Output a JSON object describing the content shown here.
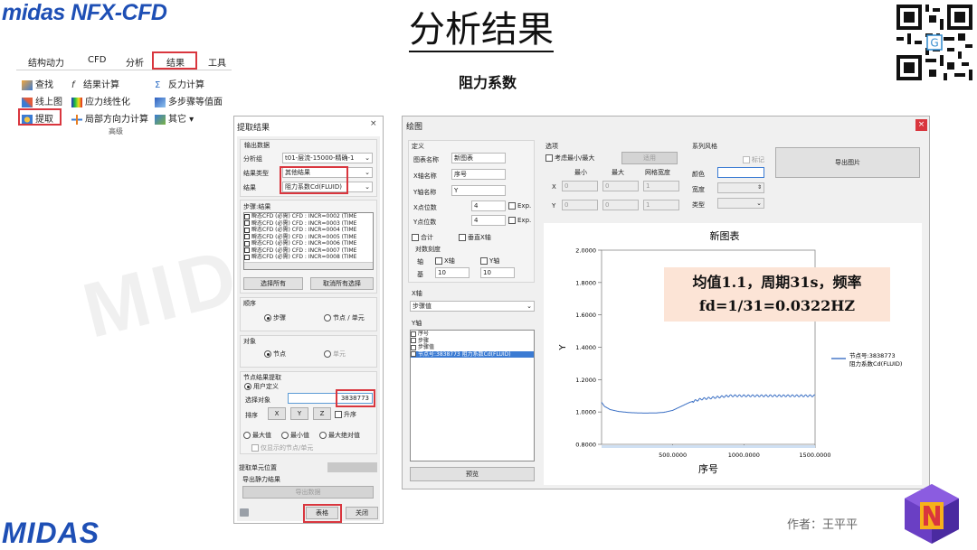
{
  "logo_top": "midas NFX-CFD",
  "logo_bottom": "MIDAS",
  "page_title": "分析结果",
  "subtitle": "阻力系数",
  "author": "作者：王平平",
  "watermark": "MIDAS",
  "ribbon": {
    "tabs": [
      "结构动力",
      "CFD",
      "分析",
      "结果",
      "工具"
    ],
    "items": {
      "find": "查找",
      "result_calc": "结果计算",
      "reaction_calc": "反力计算",
      "line_plot": "线上图",
      "stress_line": "应力线性化",
      "multistep_iso": "多步骤等值面",
      "extract": "提取",
      "local_dir": "局部方向力计算",
      "other": "其它",
      "group": "高级"
    }
  },
  "extract_dialog": {
    "title": "提取结果",
    "close": "×",
    "output_data": "输出数据",
    "analysis_group_label": "分析组",
    "analysis_group_value": "t01-层流-15000-精确-1",
    "result_type_label": "结果类型",
    "result_type_value": "其他结果",
    "result_label": "结果",
    "result_value": "阻力系数Cd(FLUID)",
    "steps_label": "步骤:结果",
    "steps": [
      "瞬态CFD (必需) CFD : INCR=0002 (TIME",
      "瞬态CFD (必需) CFD : INCR=0003 (TIME",
      "瞬态CFD (必需) CFD : INCR=0004 (TIME",
      "瞬态CFD (必需) CFD : INCR=0005 (TIME",
      "瞬态CFD (必需) CFD : INCR=0006 (TIME",
      "瞬态CFD (必需) CFD : INCR=0007 (TIME",
      "瞬态CFD (必需) CFD : INCR=0008 (TIME"
    ],
    "select_all": "选择所有",
    "deselect_all": "取消所有选择",
    "order_label": "顺序",
    "order_step": "步骤",
    "order_node": "节点 / 单元",
    "object_label": "对象",
    "object_node": "节点",
    "object_elem": "单元",
    "node_extract_label": "节点结果提取",
    "user_defined": "用户定义",
    "select_object": "选择对象",
    "select_value": "3838773",
    "sort_label": "排序",
    "sort_x": "X",
    "sort_y": "Y",
    "sort_z": "Z",
    "ascending": "升序",
    "max": "最大值",
    "min": "最小值",
    "abs_max": "最大绝对值",
    "only_shown": "仅显示的节点/单元",
    "elem_position": "提取单元位置",
    "export_static": "导出静力结果",
    "export_data": "导出数据",
    "table_btn": "表格",
    "close_btn": "关闭"
  },
  "graph_dialog": {
    "title": "绘图",
    "close": "×",
    "define_label": "定义",
    "chart_name_label": "图表名称",
    "chart_name_value": "新图表",
    "x_axis_name_label": "X轴名称",
    "x_axis_name_value": "序号",
    "y_axis_name_label": "Y轴名称",
    "y_axis_name_value": "Y",
    "x_digits_label": "X点位数",
    "x_digits_value": "4",
    "y_digits_label": "Y点位数",
    "y_digits_value": "4",
    "exp": "Exp.",
    "sum": "合计",
    "vertical_x": "垂直X轴",
    "log_scale": "对数刻度",
    "axis": "轴",
    "x_axis": "X轴",
    "y_axis": "Y轴",
    "base": "基",
    "base_x": "10",
    "base_y": "10",
    "x_axis_group": "X轴",
    "x_axis_select": "步骤值",
    "y_axis_group": "Y轴",
    "y_items": [
      "序号",
      "步骤",
      "步骤值",
      "节点号:3838773 阻力系数Cd(FLUID)"
    ],
    "preview": "预览",
    "options_label": "选项",
    "consider_minmax": "考虑最小/最大",
    "apply": "适用",
    "min": "最小",
    "max": "最大",
    "grid_width": "网格宽度",
    "opt_x": "X",
    "opt_y": "Y",
    "opt_x_min": "0",
    "opt_x_max": "0",
    "opt_x_grid": "1",
    "opt_y_min": "0",
    "opt_y_max": "0",
    "opt_y_grid": "1",
    "series_style": "系列风格",
    "marker": "标记",
    "color": "颜色",
    "width": "宽度",
    "type": "类型",
    "export_image": "导出图片"
  },
  "annotation": {
    "line1": "均值1.1，周期31s，频率",
    "line2": "fd=1/31=0.0322HZ"
  },
  "chart_data": {
    "type": "line",
    "title": "新图表",
    "xlabel": "序号",
    "ylabel": "Y",
    "xlim": [
      0,
      1500
    ],
    "ylim": [
      0.8,
      2.0
    ],
    "x_ticks": [
      "500.0000",
      "1000.0000",
      "1500.0000"
    ],
    "y_ticks": [
      "2.0000",
      "1.8000",
      "1.6000",
      "1.4000",
      "1.2000",
      "1.0000",
      "0.8000"
    ],
    "legend_position": "right",
    "series": [
      {
        "name": "节点号:3838773 阻力系数Cd(FLUID)",
        "color": "#3a6fc4",
        "x": [
          0,
          20,
          60,
          120,
          200,
          300,
          380,
          440,
          500,
          560,
          620,
          700,
          800,
          900,
          1000,
          1100,
          1200,
          1300,
          1400,
          1500
        ],
        "y": [
          1.06,
          1.035,
          1.015,
          1.003,
          0.996,
          0.993,
          0.994,
          0.998,
          1.01,
          1.035,
          1.06,
          1.08,
          1.09,
          1.1,
          1.1,
          1.1,
          1.1,
          1.1,
          1.1,
          1.1
        ],
        "oscillation_amplitude": 0.006
      }
    ]
  }
}
